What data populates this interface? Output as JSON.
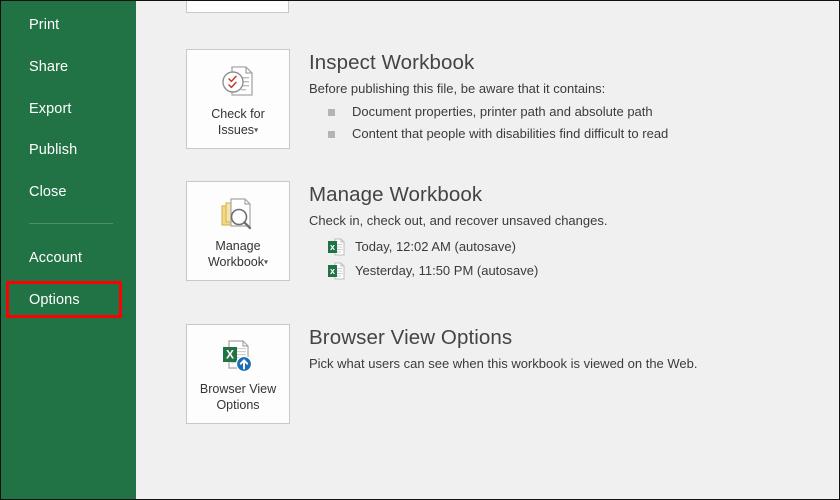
{
  "sidebar": {
    "background_color": "#217346",
    "items": [
      {
        "label": "Print",
        "name": "print"
      },
      {
        "label": "Share",
        "name": "share"
      },
      {
        "label": "Export",
        "name": "export"
      },
      {
        "label": "Publish",
        "name": "publish"
      },
      {
        "label": "Close",
        "name": "close"
      },
      {
        "label": "Account",
        "name": "account"
      },
      {
        "label": "Options",
        "name": "options"
      }
    ],
    "highlight": {
      "target": "Options",
      "color": "#ff0000"
    }
  },
  "main": {
    "sections": [
      {
        "id": "inspect-workbook",
        "title": "Inspect Workbook",
        "description": "Before publishing this file, be aware that it contains:",
        "button": {
          "label_line1": "Check for",
          "label_line2": "Issues",
          "caret": "▾",
          "icon": "check-for-issues-icon"
        },
        "bullets": [
          "Document properties, printer path and absolute path",
          "Content that people with disabilities find difficult to read"
        ]
      },
      {
        "id": "manage-workbook",
        "title": "Manage Workbook",
        "description": "Check in, check out, and recover unsaved changes.",
        "button": {
          "label_line1": "Manage",
          "label_line2": "Workbook",
          "caret": "▾",
          "icon": "manage-workbook-icon"
        },
        "versions": [
          {
            "label": "Today, 12:02 AM (autosave)",
            "icon": "excel-file-icon"
          },
          {
            "label": "Yesterday, 11:50 PM (autosave)",
            "icon": "excel-file-icon"
          }
        ]
      },
      {
        "id": "browser-view-options",
        "title": "Browser View Options",
        "description": "Pick what users can see when this workbook is viewed on the Web.",
        "button": {
          "label_line1": "Browser View",
          "label_line2": "Options",
          "caret": "",
          "icon": "browser-view-options-icon"
        }
      }
    ]
  },
  "colors": {
    "excel_green": "#217346",
    "page_background": "#f0f0f0",
    "tile_background": "#fdfdfd",
    "highlight_red": "#ff0000",
    "bullet_gray": "#b4b4b4"
  }
}
